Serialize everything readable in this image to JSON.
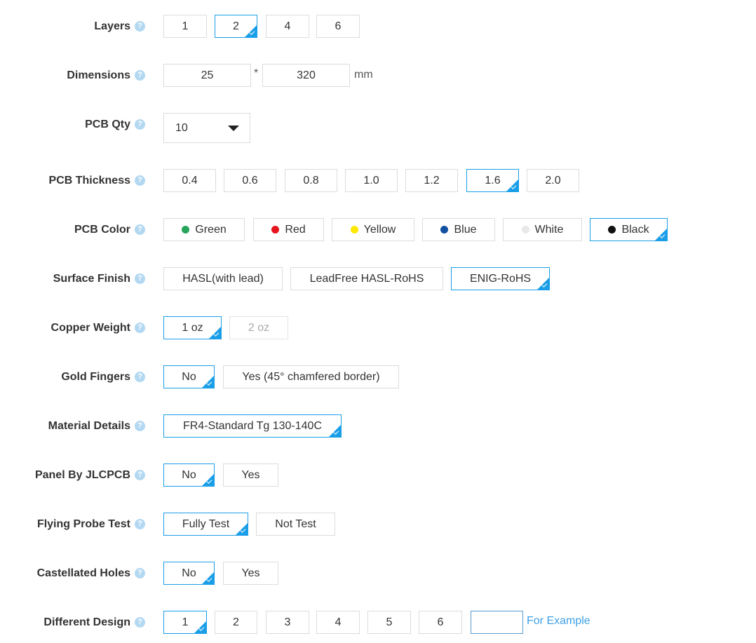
{
  "labels": {
    "layers": "Layers",
    "dimensions": "Dimensions",
    "pcb_qty": "PCB Qty",
    "pcb_thickness": "PCB Thickness",
    "pcb_color": "PCB Color",
    "surface_finish": "Surface Finish",
    "copper_weight": "Copper Weight",
    "gold_fingers": "Gold Fingers",
    "material_details": "Material Details",
    "panel_by_jlcpcb": "Panel By JLCPCB",
    "flying_probe_test": "Flying Probe Test",
    "castellated_holes": "Castellated Holes",
    "different_design": "Different Design"
  },
  "help_glyph": "?",
  "layers": {
    "options": [
      "1",
      "2",
      "4",
      "6"
    ],
    "selected": "2"
  },
  "dimensions": {
    "width": "25",
    "height": "320",
    "separator": "*",
    "unit": "mm"
  },
  "pcb_qty": {
    "value": "10"
  },
  "pcb_thickness": {
    "options": [
      "0.4",
      "0.6",
      "0.8",
      "1.0",
      "1.2",
      "1.6",
      "2.0"
    ],
    "selected": "1.6"
  },
  "pcb_color": {
    "options": [
      {
        "label": "Green",
        "color": "#27a55b"
      },
      {
        "label": "Red",
        "color": "#e6141e"
      },
      {
        "label": "Yellow",
        "color": "#ffe800"
      },
      {
        "label": "Blue",
        "color": "#1250a0"
      },
      {
        "label": "White",
        "color": "#e8e8e8"
      },
      {
        "label": "Black",
        "color": "#111111"
      }
    ],
    "selected": "Black"
  },
  "surface_finish": {
    "options": [
      "HASL(with lead)",
      "LeadFree HASL-RoHS",
      "ENIG-RoHS"
    ],
    "selected": "ENIG-RoHS"
  },
  "copper_weight": {
    "options": [
      "1 oz",
      "2 oz"
    ],
    "selected": "1 oz",
    "disabled": [
      "2 oz"
    ]
  },
  "gold_fingers": {
    "options": [
      "No",
      "Yes (45° chamfered border)"
    ],
    "selected": "No"
  },
  "material_details": {
    "options": [
      "FR4-Standard Tg 130-140C"
    ],
    "selected": "FR4-Standard Tg 130-140C"
  },
  "panel_by_jlcpcb": {
    "options": [
      "No",
      "Yes"
    ],
    "selected": "No"
  },
  "flying_probe_test": {
    "options": [
      "Fully Test",
      "Not Test"
    ],
    "selected": "Fully Test"
  },
  "castellated_holes": {
    "options": [
      "No",
      "Yes"
    ],
    "selected": "No"
  },
  "different_design": {
    "options": [
      "1",
      "2",
      "3",
      "4",
      "5",
      "6"
    ],
    "selected": "1",
    "custom_value": "",
    "example_link": "For Example"
  },
  "colors": {
    "accent": "#1a9ee8",
    "link": "#3ea0e6",
    "help_icon": "#b3d8f1"
  }
}
